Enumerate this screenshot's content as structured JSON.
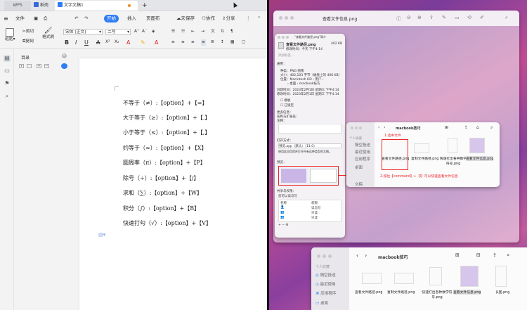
{
  "wps": {
    "tabs": {
      "home": "WPS",
      "daoke": "稻壳",
      "doc": "文字文稿1",
      "close": "✕",
      "add": "+"
    },
    "menu": {
      "file": "文件",
      "start": "开始",
      "insert": "插入",
      "layout": "页面布",
      "save": "未保存",
      "collab": "协作",
      "share": "分享"
    },
    "ribbon": {
      "cut": "剪切",
      "copy": "复制",
      "paste": "粘贴",
      "format": "格式刷",
      "font": "宋体 (正文)",
      "size": "二号",
      "bold": "B",
      "italic": "I",
      "underline": "U"
    },
    "toc": {
      "title": "目录"
    },
    "lines": [
      "不等于（≠）:【option】+【=】",
      "大于等于（≥）:【option】+【.】",
      "小于等于（≤）:【option】+【,】",
      "约等于（≈）:【option】+【X】",
      "圆周率（π）:【option】+【P】",
      "除号（÷）:【option】+【/】",
      "求和（∑）:【option】+【W】",
      "积分（∫）:【option】+【B】",
      "快速打勾（√）:【option】+【V】"
    ]
  },
  "mac": {
    "preview_title": "查看文件信息.png",
    "info": {
      "title": "“查看文件路径.png”简介",
      "file": "查看文件路径.png",
      "size": "402 KB",
      "modified": "修改时间：今天 下午4:14",
      "tags": "添加标签...",
      "general": "通用：",
      "kind": "种类：PNG 图像",
      "size_row": "大小：402,103 字节（磁盘上的 406 KB）",
      "where": "位置：Macintosh HD › 用户 ›",
      "where2": "› 桌面 › macbook技巧",
      "created": "创建时间：2023年2月1日 星期三 下午4:14",
      "modified2": "修改时间：2023年2月1日 星期三 下午4:14",
      "template": "模板",
      "locked": "已锁定",
      "more": "更多信息：",
      "name_ext": "名称与扩展名：",
      "comment": "注释：",
      "open_with": "打开方式：",
      "app": "预览.app（默认）（11.0）",
      "open_desc": "使用此应用程序打开所有这种类型的文稿。",
      "preview": "预览：",
      "sharing": "共享与权限：",
      "rw": "您可以读与写",
      "col_name": "名称",
      "col_perm": "权限",
      "perm1": "读与写",
      "perm2": "只读",
      "perm3": "只读"
    },
    "finder": {
      "title": "macbook技巧",
      "sidebar": [
        "个人收藏",
        "隔空投送",
        "最近使用",
        "应用程序",
        "桌面",
        "文稿"
      ],
      "files": [
        "查看文件路径.png",
        "复制文件路径.png",
        "快速打出各种数学符号.png",
        "查看文件信息.png"
      ],
      "annot_select": "1.选中文件",
      "annot_cmd": "2.按住【command】+【I】可以快速查看文件信息"
    },
    "finder2": {
      "title": "macbook技巧",
      "sidebar": [
        "个人收藏",
        "隔空投送",
        "最近使用",
        "应用程序",
        "桌面"
      ],
      "files": [
        "查看文件路径.png",
        "复制文件路径.png",
        "快速打出各种数学符号.png",
        "查看文件信息.png",
        "长图.png"
      ]
    }
  },
  "colors": {
    "accent": "#2f7df6",
    "annotation": "#e22222"
  }
}
